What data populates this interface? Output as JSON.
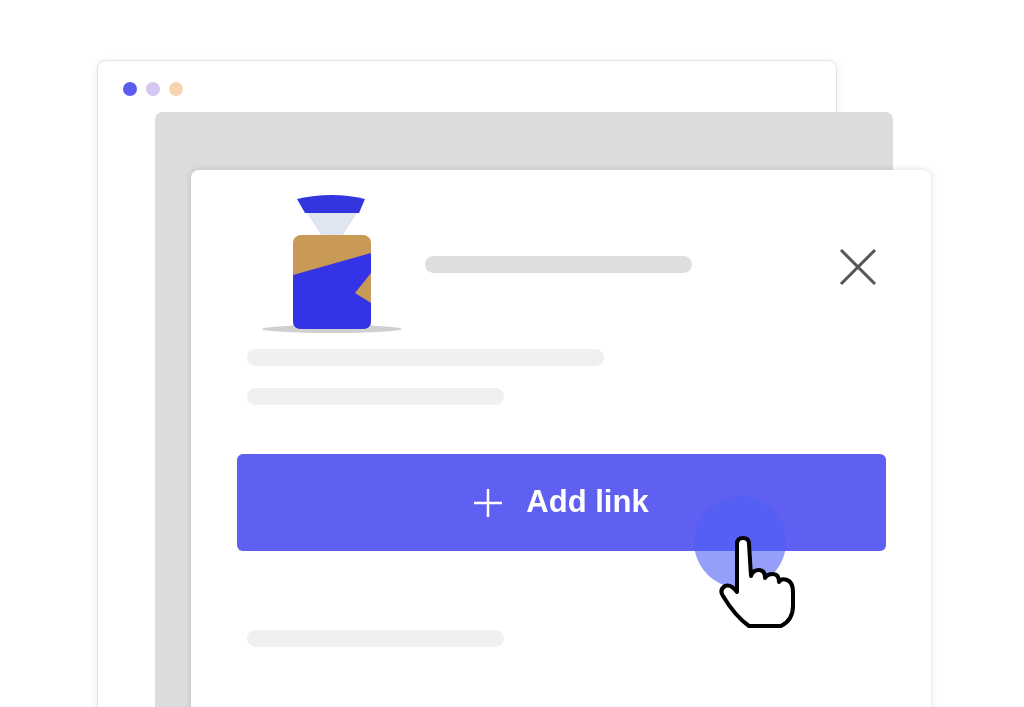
{
  "window": {
    "dots": [
      {
        "color": "#5b5bf0"
      },
      {
        "color": "#d6c6f2"
      },
      {
        "color": "#f7d4b0"
      }
    ]
  },
  "card": {
    "button": {
      "label": "Add link"
    }
  }
}
